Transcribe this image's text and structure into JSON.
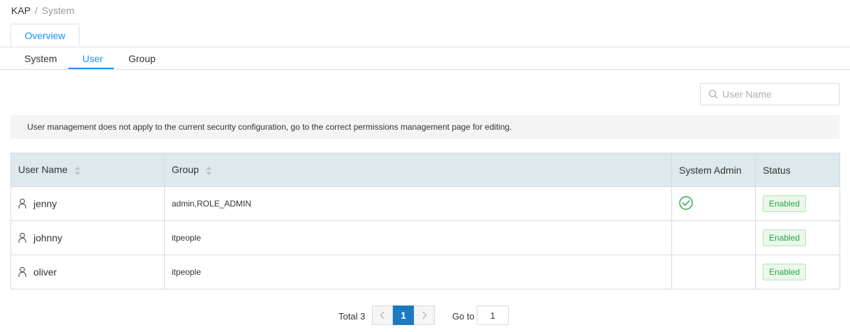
{
  "breadcrumb": {
    "root": "KAP",
    "separator": "/",
    "current": "System"
  },
  "card_tab": {
    "label": "Overview"
  },
  "subtabs": [
    {
      "label": "System"
    },
    {
      "label": "User",
      "active": true
    },
    {
      "label": "Group"
    }
  ],
  "search": {
    "placeholder": "User Name",
    "value": ""
  },
  "notice": "User management does not apply to the current security configuration, go to the correct permissions management page for editing.",
  "table": {
    "headers": {
      "user_name": "User Name",
      "group": "Group",
      "system_admin": "System Admin",
      "status": "Status"
    },
    "rows": [
      {
        "user": "jenny",
        "group": "admin,ROLE_ADMIN",
        "system_admin": true,
        "status": "Enabled"
      },
      {
        "user": "johnny",
        "group": "itpeople",
        "system_admin": false,
        "status": "Enabled"
      },
      {
        "user": "oliver",
        "group": "itpeople",
        "system_admin": false,
        "status": "Enabled"
      }
    ]
  },
  "pagination": {
    "total_label": "Total 3",
    "current_page": "1",
    "goto_label": "Go to",
    "goto_value": "1"
  },
  "colors": {
    "accent": "#1890ff",
    "header_bg": "#dde9ec",
    "status_green": "#28a745",
    "page_active": "#1b7ac0"
  }
}
